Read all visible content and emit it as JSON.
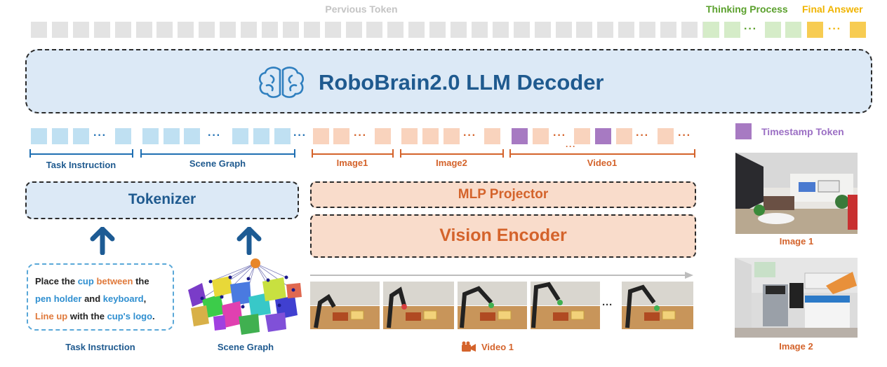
{
  "top_tokens": {
    "previous_label": "Pervious Token",
    "thinking_label": "Thinking Process",
    "final_label": "Final Answer",
    "ellipsis": "···"
  },
  "decoder": {
    "title": "RoboBrain2.0 LLM Decoder"
  },
  "token_row": {
    "ellipsis": "···",
    "extra_ellipsis": "···"
  },
  "legend": {
    "timestamp_label": "Timestamp Token"
  },
  "spans": {
    "task_instruction": "Task Instruction",
    "scene_graph": "Scene Graph",
    "image1": "Image1",
    "image2": "Image2",
    "video1": "Video1"
  },
  "modules": {
    "tokenizer": "Tokenizer",
    "mlp_projector": "MLP Projector",
    "vision_encoder": "Vision Encoder"
  },
  "instruction": {
    "t1": "Place the ",
    "cup1": "cup",
    "between": " between",
    "t2": " the",
    "pen_holder": "pen holder",
    "and": " and ",
    "keyboard": "keyboard",
    "comma": ",",
    "line_up": "Line up",
    "with_the": " with the ",
    "cups_logo": "cup's logo",
    "period": "."
  },
  "captions": {
    "task_instruction": "Task Instruction",
    "scene_graph": "Scene Graph",
    "video": "Video 1",
    "image1": "Image 1",
    "image2": "Image 2"
  },
  "video_ellipsis": "···",
  "colors": {
    "blue_accent": "#1f6fb2",
    "orange_accent": "#d4632b",
    "green_accent": "#5aa02c",
    "yellow_accent": "#f0b400",
    "purple_accent": "#9b6fc4",
    "decoder_title": "#1f5a8f"
  }
}
